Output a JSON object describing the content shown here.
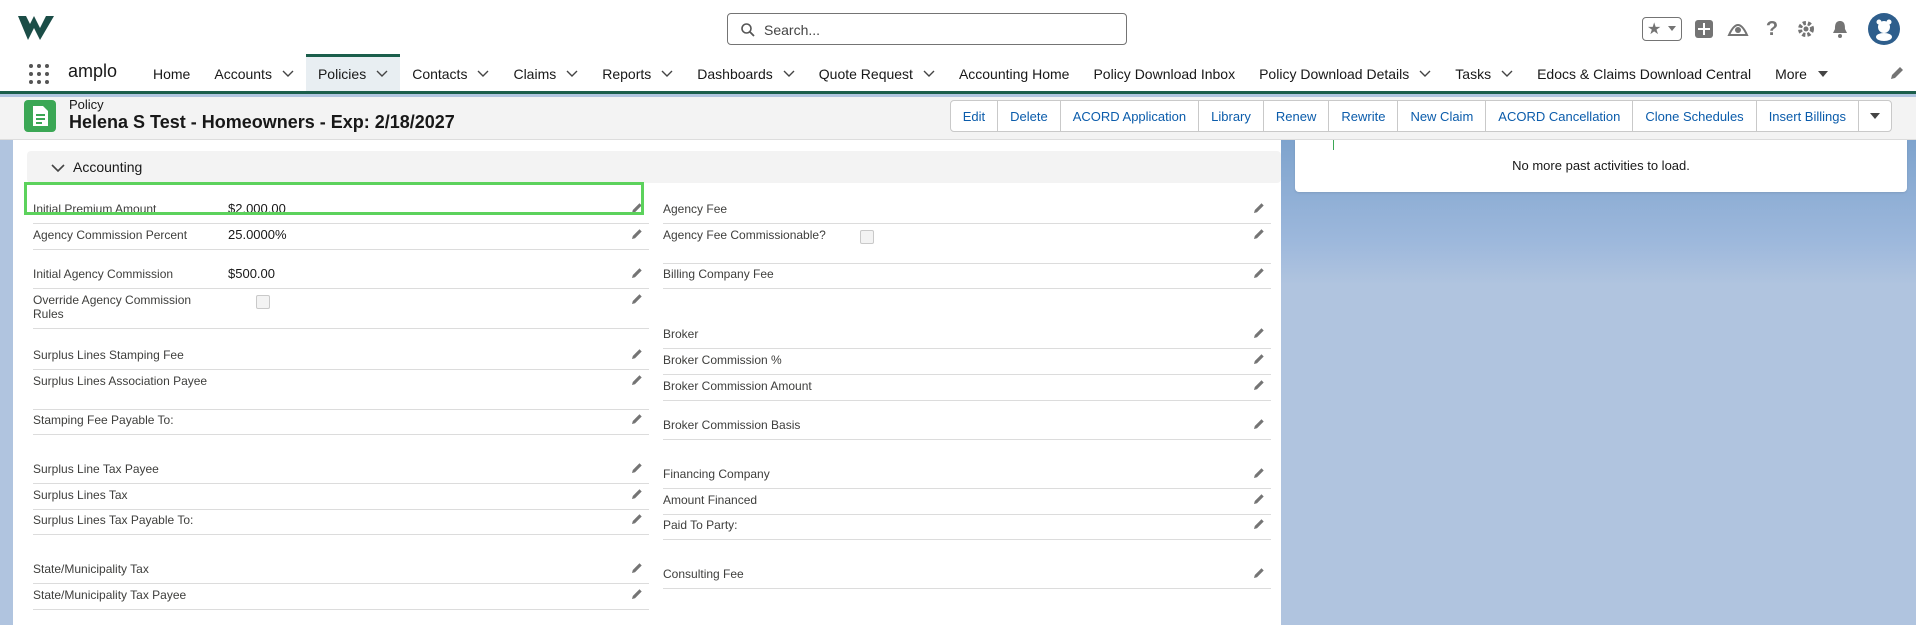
{
  "header": {
    "search_placeholder": "Search..."
  },
  "nav": {
    "app_name": "amplo",
    "items": [
      {
        "label": "Home",
        "has_menu": false
      },
      {
        "label": "Accounts",
        "has_menu": true
      },
      {
        "label": "Policies",
        "has_menu": true,
        "active": true
      },
      {
        "label": "Contacts",
        "has_menu": true
      },
      {
        "label": "Claims",
        "has_menu": true
      },
      {
        "label": "Reports",
        "has_menu": true
      },
      {
        "label": "Dashboards",
        "has_menu": true
      },
      {
        "label": "Quote Request",
        "has_menu": true
      },
      {
        "label": "Accounting Home",
        "has_menu": false
      },
      {
        "label": "Policy Download Inbox",
        "has_menu": false
      },
      {
        "label": "Policy Download Details",
        "has_menu": true
      },
      {
        "label": "Tasks",
        "has_menu": true
      },
      {
        "label": "Edocs & Claims Download Central",
        "has_menu": false
      },
      {
        "label": "More",
        "has_menu": true
      }
    ]
  },
  "record": {
    "object_type": "Policy",
    "title": "Helena S Test - Homeowners - Exp: 2/18/2027",
    "actions": [
      "Edit",
      "Delete",
      "ACORD Application",
      "Library",
      "Renew",
      "Rewrite",
      "New Claim",
      "ACORD Cancellation",
      "Clone Schedules",
      "Insert Billings"
    ]
  },
  "section": {
    "title": "Accounting"
  },
  "left_fields": {
    "initial_premium_amount": {
      "label": "Initial Premium Amount",
      "value": "$2,000.00"
    },
    "agency_commission_percent": {
      "label": "Agency Commission Percent",
      "value": "25.0000%"
    },
    "initial_agency_commission": {
      "label": "Initial Agency Commission",
      "value": "$500.00"
    },
    "override_agency_commission_rules": {
      "label": "Override Agency Commission Rules"
    },
    "surplus_lines_stamping_fee": {
      "label": "Surplus Lines Stamping Fee"
    },
    "surplus_lines_association_payee": {
      "label": "Surplus Lines Association Payee"
    },
    "stamping_fee_payable_to": {
      "label": "Stamping Fee Payable To:"
    },
    "surplus_line_tax_payee": {
      "label": "Surplus Line Tax Payee"
    },
    "surplus_lines_tax": {
      "label": "Surplus Lines Tax"
    },
    "surplus_lines_tax_payable_to": {
      "label": "Surplus Lines Tax Payable To:"
    },
    "state_municipality_tax": {
      "label": "State/Municipality Tax"
    },
    "state_municipality_tax_payee": {
      "label": "State/Municipality Tax Payee"
    }
  },
  "right_fields": {
    "agency_fee": {
      "label": "Agency Fee"
    },
    "agency_fee_commissionable": {
      "label": "Agency Fee Commissionable?"
    },
    "billing_company_fee": {
      "label": "Billing Company Fee"
    },
    "broker": {
      "label": "Broker"
    },
    "broker_commission_pct": {
      "label": "Broker Commission %"
    },
    "broker_commission_amount": {
      "label": "Broker Commission Amount"
    },
    "broker_commission_basis": {
      "label": "Broker Commission Basis"
    },
    "financing_company": {
      "label": "Financing Company"
    },
    "amount_financed": {
      "label": "Amount Financed"
    },
    "paid_to_party": {
      "label": "Paid To Party:"
    },
    "consulting_fee": {
      "label": "Consulting Fee"
    }
  },
  "activity": {
    "message": "No more past activities to load."
  },
  "colors": {
    "accent": "#1b5e4b",
    "link": "#0b5cab",
    "record_icon": "#3ba755",
    "highlight": "#5cd25c"
  }
}
